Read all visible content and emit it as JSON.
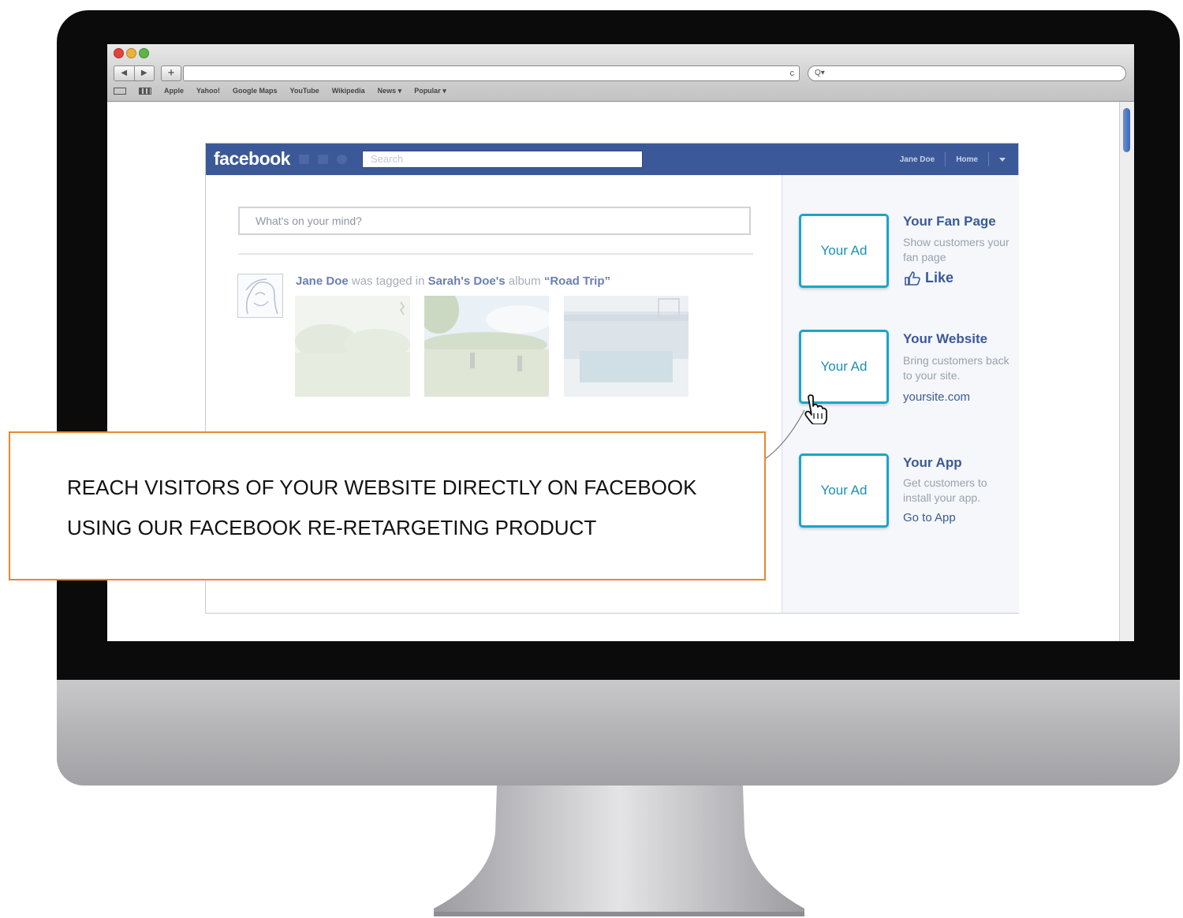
{
  "browser": {
    "nav_back": "◀",
    "nav_forward": "▶",
    "new_tab": "+",
    "reload_glyph": "c",
    "search_glyph": "Q▾",
    "bookmarks": [
      "Apple",
      "Yahoo!",
      "Google Maps",
      "YouTube",
      "Wikipedia",
      "News ▾",
      "Popular ▾"
    ]
  },
  "facebook": {
    "logo": "facebook",
    "search_placeholder": "Search",
    "nav": {
      "user": "Jane Doe",
      "home": "Home"
    },
    "composer_placeholder": "What's on your mind?",
    "story": {
      "actor": "Jane Doe",
      "verb1": " was tagged in ",
      "owner": "Sarah's Doe's",
      "verb2": " album ",
      "album": "“Road Trip”"
    },
    "ads": [
      {
        "box_label": "Your Ad",
        "title": "Your Fan Page",
        "description": "Show customers your fan page",
        "cta": "Like",
        "cta_icon": "thumbs-up-icon"
      },
      {
        "box_label": "Your Ad",
        "title": "Your Website",
        "description": "Bring customers back to your site.",
        "cta": "yoursite.com"
      },
      {
        "box_label": "Your Ad",
        "title": "Your App",
        "description": "Get customers to install your app.",
        "cta": "Go to App"
      }
    ]
  },
  "callout": {
    "line1": "REACH VISITORS OF YOUR WEBSITE DIRECTLY ON FACEBOOK",
    "line2": "USING OUR FACEBOOK RE-RETARGETING PRODUCT"
  },
  "colors": {
    "facebook_blue": "#3b5998",
    "ad_border": "#1aa5c9",
    "callout_border": "#e8872e"
  }
}
